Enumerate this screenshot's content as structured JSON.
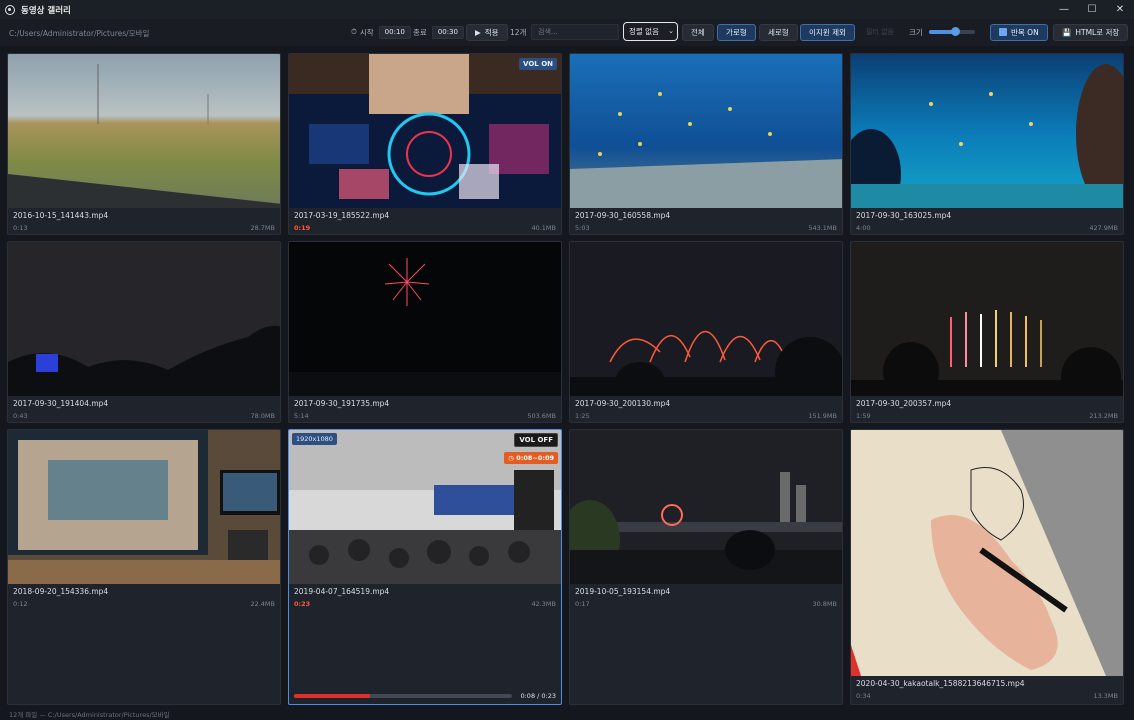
{
  "window": {
    "title": "동영상 갤러리",
    "minimize": "—",
    "maximize": "☐",
    "close": "✕"
  },
  "toolbar": {
    "path": "C:/Users/Administrator/Pictures/모바일",
    "start_label": "시작",
    "start_value": "00:10",
    "end_label": "종료",
    "end_value": "00:30",
    "apply_label": "적용",
    "count": "12개",
    "search_placeholder": "검색...",
    "sort_selected": "정렬 없음",
    "all_label": "전체",
    "landscape_label": "가로형",
    "portrait_label": "세로형",
    "exclude_images_label": "이지윈 제외",
    "faded_label": "필터 없음",
    "size_label": "크기",
    "size_value": 0.55,
    "repeat_label": "반복 ON",
    "save_html_label": "HTML로 저장"
  },
  "videos": [
    {
      "name": "2016-10-15_141443.mp4",
      "duration": "0:13",
      "size": "28.7MB"
    },
    {
      "name": "2017-03-19_185522.mp4",
      "duration": "0:19",
      "size": "40.1MB",
      "badge": "VOL ON"
    },
    {
      "name": "2017-09-30_160558.mp4",
      "duration": "5:03",
      "size": "543.1MB"
    },
    {
      "name": "2017-09-30_163025.mp4",
      "duration": "4:00",
      "size": "427.9MB"
    },
    {
      "name": "2017-09-30_191404.mp4",
      "duration": "0:43",
      "size": "78.0MB"
    },
    {
      "name": "2017-09-30_191735.mp4",
      "duration": "5:14",
      "size": "503.6MB"
    },
    {
      "name": "2017-09-30_200130.mp4",
      "duration": "1:25",
      "size": "151.9MB"
    },
    {
      "name": "2017-09-30_200357.mp4",
      "duration": "1:59",
      "size": "213.2MB"
    },
    {
      "name": "2018-09-20_154336.mp4",
      "duration": "0:12",
      "size": "22.4MB"
    },
    {
      "name": "2019-04-07_164519.mp4",
      "duration": "0:23",
      "size": "42.3MB",
      "resolution": "1920x1080",
      "badge": "VOL OFF",
      "range": "0:08~0:09",
      "progress": 0.35,
      "progress_text": "0:08 / 0:23"
    },
    {
      "name": "2019-10-05_193154.mp4",
      "duration": "0:17",
      "size": "30.8MB"
    },
    {
      "name": "2020-04-30_kakaotalk_1588213646715.mp4",
      "duration": "0:34",
      "size": "13.3MB"
    }
  ],
  "status": {
    "text": "12개 파일 — C:/Users/Administrator/Pictures/모바일"
  },
  "colors": {
    "accent": "#4e8fe6",
    "progress": "#e0302a",
    "range_badge": "#e25d24",
    "vol_on": "#2c4f82"
  }
}
